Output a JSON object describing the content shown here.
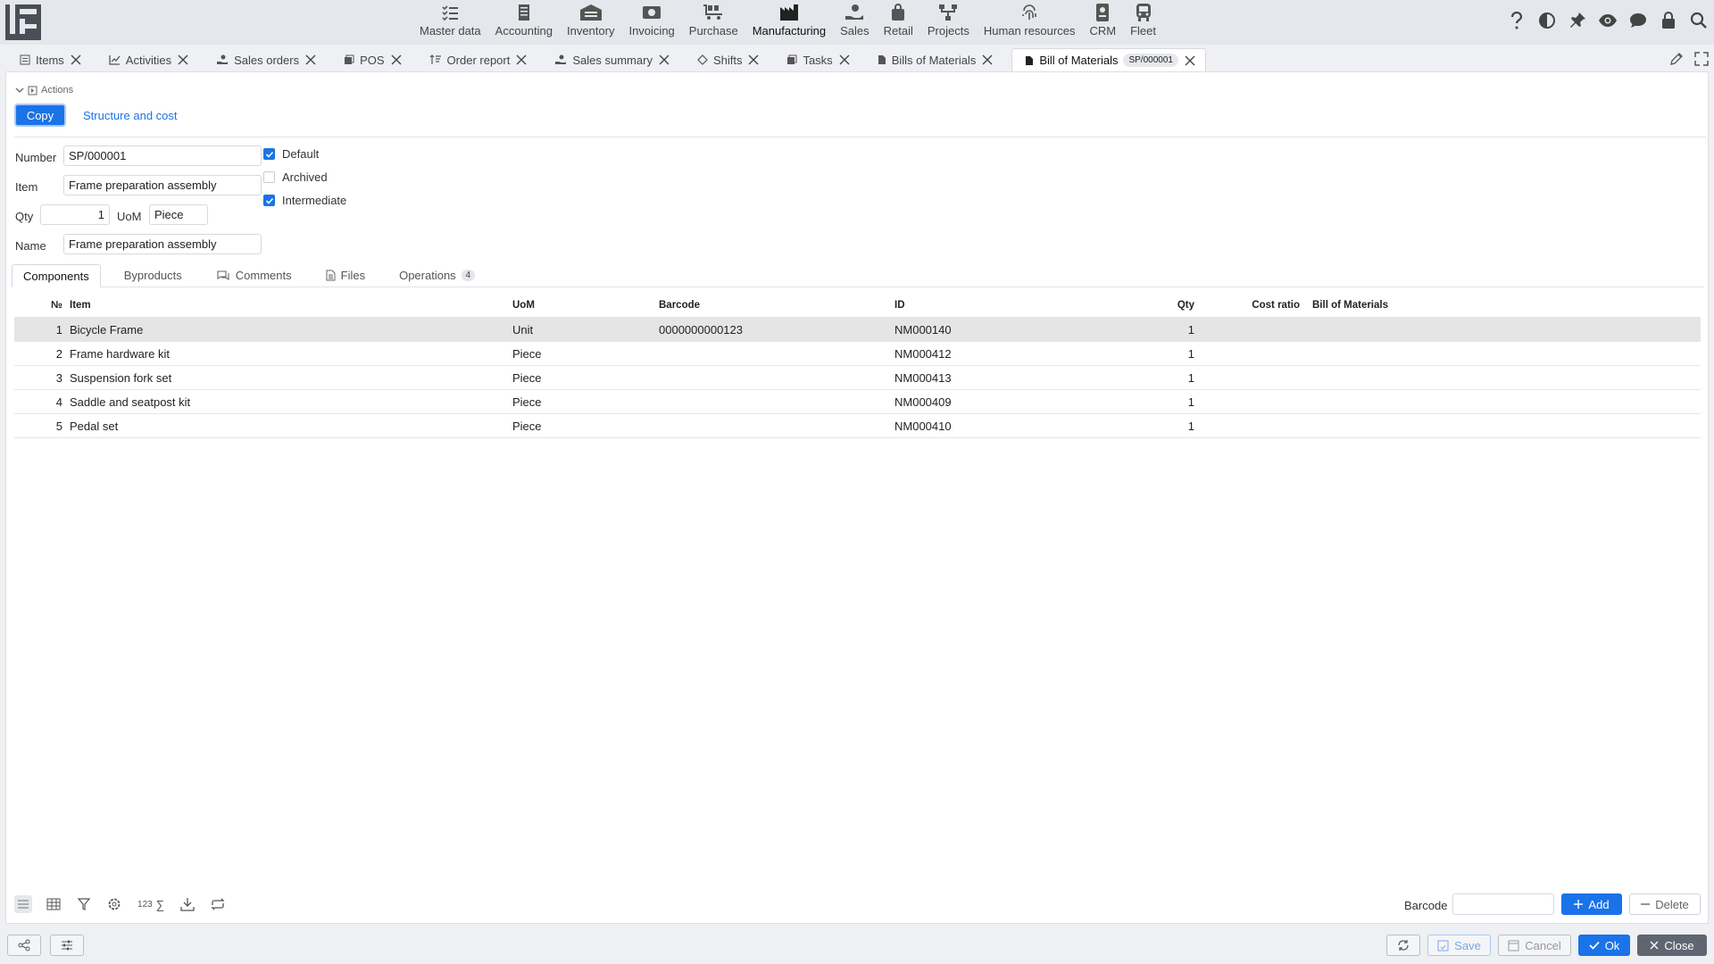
{
  "logo": {
    "glyph": "logo-icon"
  },
  "modules": [
    {
      "label": "Master data",
      "icon": "checklist-icon"
    },
    {
      "label": "Accounting",
      "icon": "ledger-icon"
    },
    {
      "label": "Inventory",
      "icon": "warehouse-icon"
    },
    {
      "label": "Invoicing",
      "icon": "cash-icon"
    },
    {
      "label": "Purchase",
      "icon": "cart-icon"
    },
    {
      "label": "Manufacturing",
      "icon": "factory-icon"
    },
    {
      "label": "Sales",
      "icon": "hand-coin-icon"
    },
    {
      "label": "Retail",
      "icon": "bag-icon"
    },
    {
      "label": "Projects",
      "icon": "tree-icon"
    },
    {
      "label": "Human resources",
      "icon": "fingerprint-icon"
    },
    {
      "label": "CRM",
      "icon": "badge-icon"
    },
    {
      "label": "Fleet",
      "icon": "bus-icon"
    }
  ],
  "tabs": [
    {
      "label": "Items"
    },
    {
      "label": "Activities"
    },
    {
      "label": "Sales orders"
    },
    {
      "label": "POS"
    },
    {
      "label": "Order report"
    },
    {
      "label": "Sales summary"
    },
    {
      "label": "Shifts"
    },
    {
      "label": "Tasks"
    },
    {
      "label": "Bills of Materials"
    },
    {
      "label": "Bill of Materials",
      "badge": "SP/000001"
    }
  ],
  "actions": {
    "header": "Actions",
    "copy": "Copy",
    "structure": "Structure and cost"
  },
  "form": {
    "number_label": "Number",
    "number": "SP/000001",
    "item_label": "Item",
    "item": "Frame preparation assembly",
    "qty_label": "Qty",
    "qty": "1",
    "uom_label": "UoM",
    "uom": "Piece",
    "name_label": "Name",
    "name": "Frame preparation assembly",
    "default_label": "Default",
    "archived_label": "Archived",
    "intermediate_label": "Intermediate"
  },
  "subtabs": {
    "components": "Components",
    "byproducts": "Byproducts",
    "comments": "Comments",
    "files": "Files",
    "operations": "Operations",
    "operations_count": "4"
  },
  "table": {
    "headers": {
      "num": "№",
      "item": "Item",
      "uom": "UoM",
      "barcode": "Barcode",
      "id": "ID",
      "qty": "Qty",
      "cost": "Cost ratio",
      "bom": "Bill of Materials"
    },
    "rows": [
      {
        "num": "1",
        "item": "Bicycle Frame",
        "uom": "Unit",
        "barcode": "0000000000123",
        "id": "NM000140",
        "qty": "1"
      },
      {
        "num": "2",
        "item": "Frame hardware kit",
        "uom": "Piece",
        "barcode": "",
        "id": "NM000412",
        "qty": "1"
      },
      {
        "num": "3",
        "item": "Suspension fork set",
        "uom": "Piece",
        "barcode": "",
        "id": "NM000413",
        "qty": "1"
      },
      {
        "num": "4",
        "item": "Saddle and seatpost kit",
        "uom": "Piece",
        "barcode": "",
        "id": "NM000409",
        "qty": "1"
      },
      {
        "num": "5",
        "item": "Pedal set",
        "uom": "Piece",
        "barcode": "",
        "id": "NM000410",
        "qty": "1"
      }
    ]
  },
  "bottom": {
    "numbers_label": "123",
    "sum_label": "∑",
    "barcode_label": "Barcode",
    "add": "Add",
    "delete": "Delete"
  },
  "footer": {
    "save": "Save",
    "cancel": "Cancel",
    "ok": "Ok",
    "close": "Close"
  },
  "colors": {
    "accent": "#1a73e8",
    "topbar": "#e4e7eb",
    "selected_row": "#e5e5e5"
  }
}
